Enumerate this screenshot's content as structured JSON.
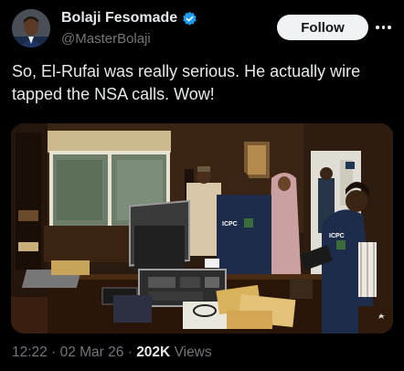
{
  "author": {
    "display_name": "Bolaji Fesomade",
    "handle": "@MasterBolaji",
    "verified": true
  },
  "follow_label": "Follow",
  "tweet": {
    "text": "So, El-Rufai was really serious. He actually wire tapped the NSA calls. Wow!"
  },
  "image_labels": {
    "vest_left": "ICPC",
    "vest_right": "ICPC"
  },
  "meta": {
    "time": "12:22",
    "separator": "·",
    "date": "02 Mar 26",
    "views_count": "202K",
    "views_label": "Views"
  },
  "colors": {
    "verified_badge": "#1d9bf0",
    "background": "#000000",
    "secondary_text": "#71767b"
  }
}
